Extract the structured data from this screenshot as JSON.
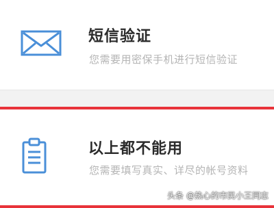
{
  "options": [
    {
      "icon": "envelope-icon",
      "title": "短信验证",
      "description": "您需要用密保手机进行短信验证"
    },
    {
      "icon": "clipboard-icon",
      "title": "以上都不能用",
      "description": "您需要填写真实、详尽的帐号资料"
    }
  ],
  "watermark": "头条 @热心的市民小王同志",
  "colors": {
    "icon_blue": "#4a8fd8",
    "highlight_red": "#e8333a",
    "title_text": "#2b2b2b",
    "description_text": "#b4b4b4"
  }
}
